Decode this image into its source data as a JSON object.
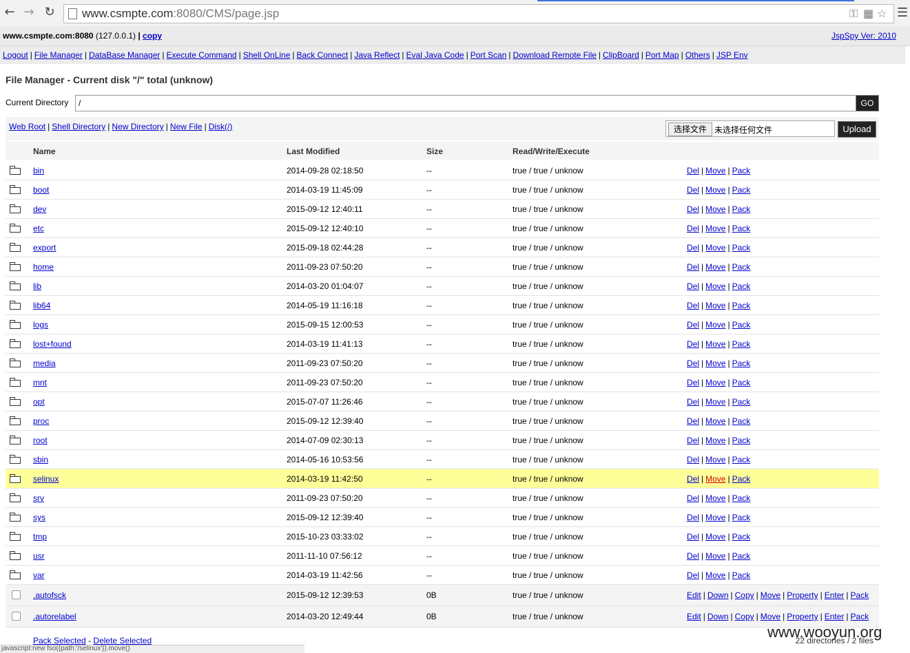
{
  "browser": {
    "url_host": "www.csmpte.com",
    "url_rest": ":8080/CMS/page.jsp",
    "back_icon": "arrow-left",
    "forward_icon": "arrow-right",
    "reload_icon": "reload"
  },
  "header": {
    "host": "www.csmpte.com:8080",
    "ip": "(127.0.0.1)",
    "sep": "|",
    "copy_label": "copy",
    "version": "JspSpy Ver: 2010"
  },
  "menu": [
    "Logout",
    "File Manager",
    "DataBase Manager",
    "Execute Command",
    "Shell OnLine",
    "Back Connect",
    "Java Reflect",
    "Eval Java Code",
    "Port Scan",
    "Download Remote File",
    "ClipBoard",
    "Port Map",
    "Others",
    "JSP Env"
  ],
  "main": {
    "title": "File Manager - Current disk \"/\" total (unknow)",
    "current_dir_label": "Current Directory",
    "current_dir_value": "/",
    "go_label": "GO",
    "tool_links": [
      "Web Root",
      "Shell Directory",
      "New Directory",
      "New File",
      "Disk(/)"
    ],
    "choose_file_label": "选择文件",
    "no_file_label": "未选择任何文件",
    "upload_label": "Upload"
  },
  "table": {
    "headers": {
      "name": "Name",
      "modified": "Last Modified",
      "size": "Size",
      "rwx": "Read/Write/Execute"
    },
    "dir_actions": [
      "Del",
      "Move",
      "Pack"
    ],
    "file_actions": [
      "Edit",
      "Down",
      "Copy",
      "Move",
      "Property",
      "Enter",
      "Pack"
    ],
    "dirs": [
      {
        "name": "bin",
        "modified": "2014-09-28 02:18:50",
        "size": "--",
        "rwx": "true / true / unknow"
      },
      {
        "name": "boot",
        "modified": "2014-03-19 11:45:09",
        "size": "--",
        "rwx": "true / true / unknow"
      },
      {
        "name": "dev",
        "modified": "2015-09-12 12:40:11",
        "size": "--",
        "rwx": "true / true / unknow"
      },
      {
        "name": "etc",
        "modified": "2015-09-12 12:40:10",
        "size": "--",
        "rwx": "true / true / unknow"
      },
      {
        "name": "export",
        "modified": "2015-09-18 02:44:28",
        "size": "--",
        "rwx": "true / true / unknow"
      },
      {
        "name": "home",
        "modified": "2011-09-23 07:50:20",
        "size": "--",
        "rwx": "true / true / unknow"
      },
      {
        "name": "lib",
        "modified": "2014-03-20 01:04:07",
        "size": "--",
        "rwx": "true / true / unknow"
      },
      {
        "name": "lib64",
        "modified": "2014-05-19 11:16:18",
        "size": "--",
        "rwx": "true / true / unknow"
      },
      {
        "name": "logs",
        "modified": "2015-09-15 12:00:53",
        "size": "--",
        "rwx": "true / true / unknow"
      },
      {
        "name": "lost+found",
        "modified": "2014-03-19 11:41:13",
        "size": "--",
        "rwx": "true / true / unknow"
      },
      {
        "name": "media",
        "modified": "2011-09-23 07:50:20",
        "size": "--",
        "rwx": "true / true / unknow"
      },
      {
        "name": "mnt",
        "modified": "2011-09-23 07:50:20",
        "size": "--",
        "rwx": "true / true / unknow"
      },
      {
        "name": "opt",
        "modified": "2015-07-07 11:26:46",
        "size": "--",
        "rwx": "true / true / unknow"
      },
      {
        "name": "proc",
        "modified": "2015-09-12 12:39:40",
        "size": "--",
        "rwx": "true / true / unknow"
      },
      {
        "name": "root",
        "modified": "2014-07-09 02:30:13",
        "size": "--",
        "rwx": "true / true / unknow"
      },
      {
        "name": "sbin",
        "modified": "2014-05-16 10:53:56",
        "size": "--",
        "rwx": "true / true / unknow"
      },
      {
        "name": "selinux",
        "modified": "2014-03-19 11:42:50",
        "size": "--",
        "rwx": "true / true / unknow",
        "highlight": true
      },
      {
        "name": "srv",
        "modified": "2011-09-23 07:50:20",
        "size": "--",
        "rwx": "true / true / unknow"
      },
      {
        "name": "sys",
        "modified": "2015-09-12 12:39:40",
        "size": "--",
        "rwx": "true / true / unknow"
      },
      {
        "name": "tmp",
        "modified": "2015-10-23 03:33:02",
        "size": "--",
        "rwx": "true / true / unknow"
      },
      {
        "name": "usr",
        "modified": "2011-11-10 07:56:12",
        "size": "--",
        "rwx": "true / true / unknow"
      },
      {
        "name": "var",
        "modified": "2014-03-19 11:42:56",
        "size": "--",
        "rwx": "true / true / unknow"
      }
    ],
    "files": [
      {
        "name": ".autofsck",
        "modified": "2015-09-12 12:39:53",
        "size": "0B",
        "rwx": "true / true / unknow"
      },
      {
        "name": ".autorelabel",
        "modified": "2014-03-20 12:49:44",
        "size": "0B",
        "rwx": "true / true / unknow"
      }
    ]
  },
  "footer": {
    "pack_selected": "Pack Selected",
    "dash": "-",
    "delete_selected": "Delete Selected",
    "count": "22 directories / 2 files"
  },
  "status_text": "javascript:new fso({path:'/selinux'}).move()",
  "watermark": "www.wooyun.org"
}
